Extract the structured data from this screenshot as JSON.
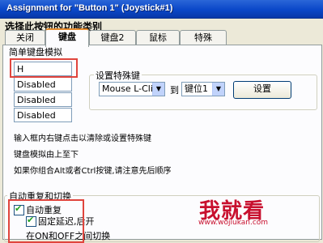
{
  "window": {
    "title": "Assignment for \"Button 1\" (Joystick#1)"
  },
  "heading": "选择此按钮的功能类别",
  "tabs": [
    "关闭",
    "键盘",
    "键盘2",
    "鼠标",
    "特殊"
  ],
  "active_tab": "键盘",
  "simple_key_group": {
    "label": "简单键盘模拟",
    "fields": [
      "H",
      "Disabled",
      "Disabled",
      "Disabled"
    ]
  },
  "special_key_group": {
    "label": "设置特殊键",
    "mouse_select": "Mouse L-Click",
    "to_label": "到",
    "slot_select": "键位1",
    "set_button": "设置"
  },
  "notes": [
    "输入框内右键点击以清除或设置特殊键",
    "键盘模拟由上至下",
    "如果你组合Alt或者Ctrl按键,请注意先后顺序"
  ],
  "repeat_group": {
    "label": "自动重复和切换",
    "auto_repeat": {
      "label": "自动重复",
      "checked": true
    },
    "fixed_delay": {
      "label": "固定延迟,后开",
      "checked": true
    },
    "toggle_text": "在ON和OFF之间切换"
  },
  "watermark": {
    "logo": "我就看",
    "url": "www.wojiukan.com"
  }
}
